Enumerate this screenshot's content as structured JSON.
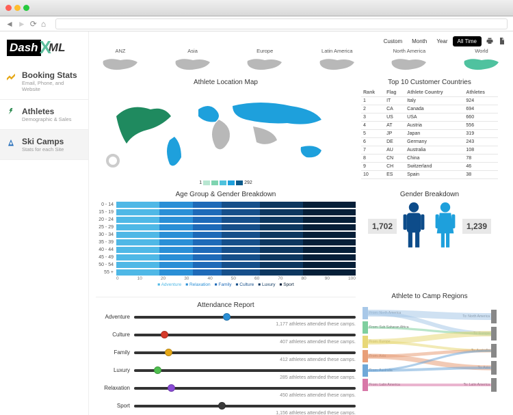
{
  "logo": {
    "part1": "Dash",
    "part2": "ML"
  },
  "time_range": [
    "Custom",
    "Month",
    "Year",
    "All Time"
  ],
  "time_active": 3,
  "nav": [
    {
      "title": "Booking Stats",
      "sub": "Email, Phone, and Website"
    },
    {
      "title": "Athletes",
      "sub": "Demographic & Sales"
    },
    {
      "title": "Ski Camps",
      "sub": "Stats for each Site"
    }
  ],
  "nav_active": 2,
  "regions": [
    "ANZ",
    "Asia",
    "Europe",
    "Latin America",
    "North America",
    "World"
  ],
  "region_active": 5,
  "map": {
    "title": "Athlete Location Map",
    "legend_min": "1",
    "legend_max": "292"
  },
  "countries": {
    "title": "Top 10 Customer Countries",
    "cols": [
      "Rank",
      "Flag",
      "Athlete Country",
      "Athletes"
    ],
    "rows": [
      [
        "1",
        "IT",
        "Italy",
        "924"
      ],
      [
        "2",
        "CA",
        "Canada",
        "694"
      ],
      [
        "3",
        "US",
        "USA",
        "660"
      ],
      [
        "4",
        "AT",
        "Austria",
        "556"
      ],
      [
        "5",
        "JP",
        "Japan",
        "319"
      ],
      [
        "6",
        "DE",
        "Germany",
        "243"
      ],
      [
        "7",
        "AU",
        "Australia",
        "108"
      ],
      [
        "8",
        "CN",
        "China",
        "78"
      ],
      [
        "9",
        "CH",
        "Switzerland",
        "46"
      ],
      [
        "10",
        "ES",
        "Spain",
        "38"
      ]
    ]
  },
  "age": {
    "title": "Age Group & Gender Breakdown",
    "bins": [
      "0 - 14",
      "15 - 19",
      "20 - 24",
      "25 - 29",
      "30 - 34",
      "35 - 39",
      "40 - 44",
      "45 - 49",
      "50 - 54",
      "55 +"
    ],
    "ticks": [
      "0",
      "10",
      "20",
      "30",
      "40",
      "50",
      "60",
      "70",
      "80",
      "90",
      "100"
    ],
    "legend": [
      "Adventure",
      "Relaxation",
      "Family",
      "Culture",
      "Luxury",
      "Sport"
    ]
  },
  "gender": {
    "title": "Gender Breakdown",
    "male": "1,702",
    "female": "1,239"
  },
  "attendance": {
    "title": "Attendance Report",
    "rows": [
      {
        "label": "Adventure",
        "pct": 40,
        "color": "#2a8fd6",
        "text": "1,177 athletes attended these camps."
      },
      {
        "label": "Culture",
        "pct": 12,
        "color": "#d63a2a",
        "text": "407 athletes attended these camps."
      },
      {
        "label": "Family",
        "pct": 14,
        "color": "#e6a817",
        "text": "412 athletes attended these camps."
      },
      {
        "label": "Luxury",
        "pct": 9,
        "color": "#4fbf4f",
        "text": "285 athletes attended these camps."
      },
      {
        "label": "Relaxation",
        "pct": 15,
        "color": "#8a4bd6",
        "text": "450 athletes attended these camps."
      },
      {
        "label": "Sport",
        "pct": 38,
        "color": "#3a3a3a",
        "text": "1,156 athletes attended these camps."
      }
    ]
  },
  "sankey": {
    "title": "Athlete to Camp Regions",
    "from": [
      "From: North America",
      "From: Sub Saharan Africa",
      "From: Europe",
      "From: Asia",
      "From: Australia",
      "From: Latin America"
    ],
    "to": [
      "To: North America",
      "To: Europe",
      "To: Australia",
      "To: Asia",
      "To: Latin America"
    ]
  },
  "chart_data": [
    {
      "type": "table",
      "title": "Top 10 Customer Countries",
      "categories": [
        "Italy",
        "Canada",
        "USA",
        "Austria",
        "Japan",
        "Germany",
        "Australia",
        "China",
        "Switzerland",
        "Spain"
      ],
      "values": [
        924,
        694,
        660,
        556,
        319,
        243,
        108,
        78,
        46,
        38
      ]
    },
    {
      "type": "bar",
      "title": "Age Group & Gender Breakdown",
      "categories": [
        "0-14",
        "15-19",
        "20-24",
        "25-29",
        "30-34",
        "35-39",
        "40-44",
        "45-49",
        "50-54",
        "55+"
      ],
      "series": [
        {
          "name": "Adventure"
        },
        {
          "name": "Relaxation"
        },
        {
          "name": "Family"
        },
        {
          "name": "Culture"
        },
        {
          "name": "Luxury"
        },
        {
          "name": "Sport"
        }
      ],
      "xlim": [
        0,
        100
      ],
      "note": "100% stacked, per-segment values not labeled"
    },
    {
      "type": "bar",
      "title": "Gender Breakdown",
      "categories": [
        "Male",
        "Female"
      ],
      "values": [
        1702,
        1239
      ]
    },
    {
      "type": "bar",
      "title": "Attendance Report",
      "categories": [
        "Adventure",
        "Culture",
        "Family",
        "Luxury",
        "Relaxation",
        "Sport"
      ],
      "values": [
        1177,
        407,
        412,
        285,
        450,
        1156
      ]
    }
  ]
}
